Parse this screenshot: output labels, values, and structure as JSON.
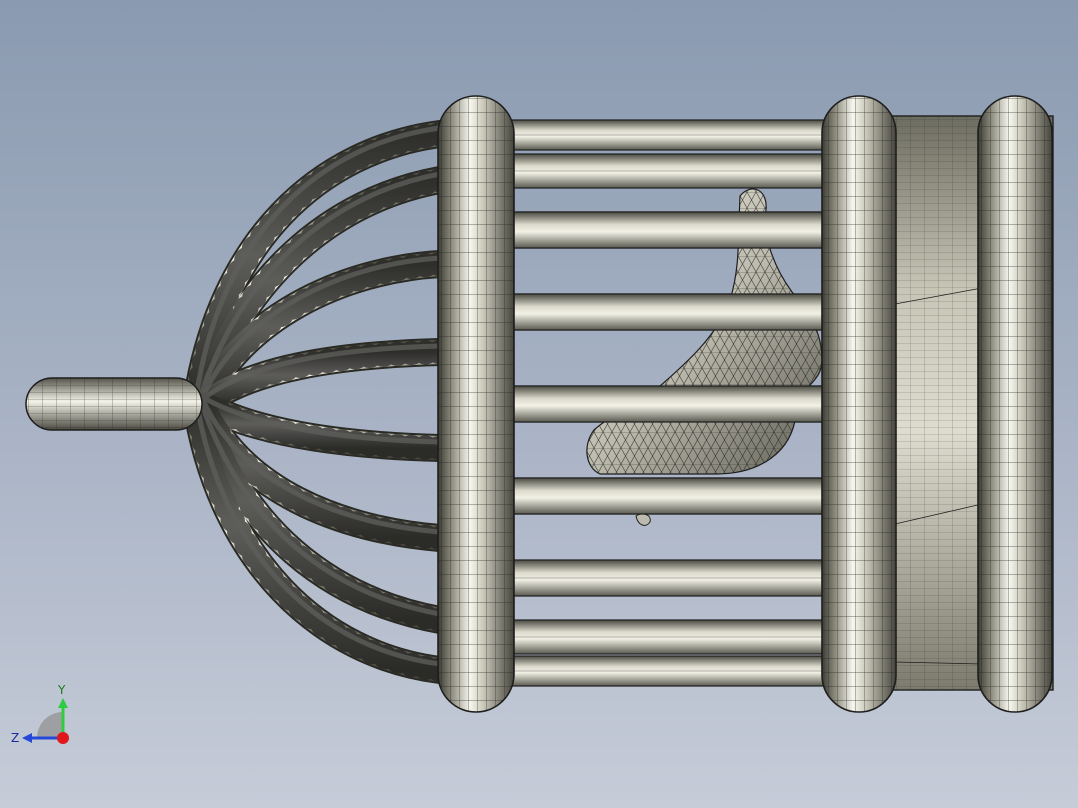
{
  "viewport": {
    "triad": {
      "x_label": "",
      "y_label": "Y",
      "z_label": "Z"
    }
  },
  "colors": {
    "background_top": "#8a9ab0",
    "background_bottom": "#c6ccd8",
    "metal_light": "#f7f7ef",
    "metal_mid": "#b8b6a6",
    "metal_dark": "#3c3c34",
    "mesh_line": "#1e1e1e",
    "axis_y": "#2ecc40",
    "axis_z": "#2548d8",
    "axis_x": "#e0181c"
  }
}
